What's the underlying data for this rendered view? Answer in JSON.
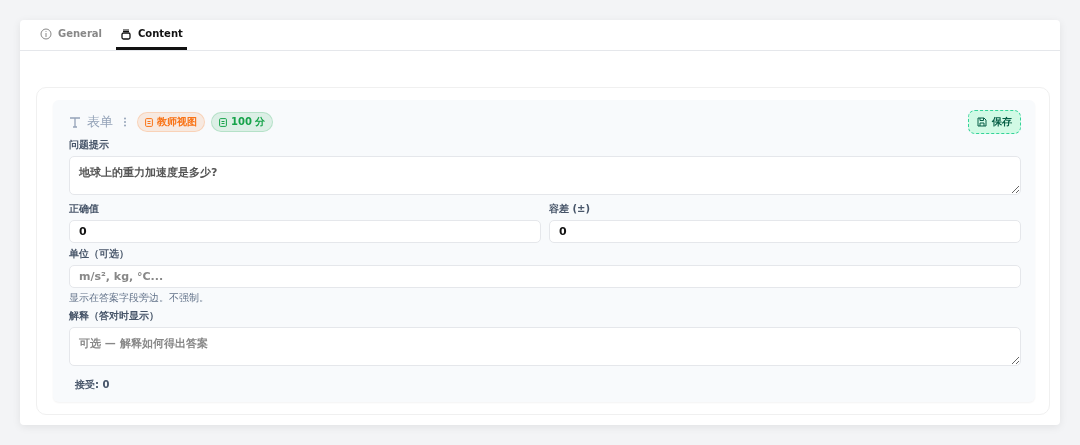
{
  "tabs": [
    {
      "label": "General",
      "kind": "info",
      "selected": false
    },
    {
      "label": "Content",
      "kind": "content",
      "selected": true
    }
  ],
  "block": {
    "title": "表单",
    "badges": [
      {
        "label": "教师视图",
        "color": "#f97316"
      },
      {
        "label": "100 分",
        "color": "#16a34a"
      }
    ],
    "save_button": "保存",
    "fields": [
      {
        "kind": "textarea",
        "label": "问题提示",
        "value": "地球上的重力加速度是多少?"
      },
      {
        "kind": "pair",
        "items": [
          {
            "label": "正确值",
            "value": "0"
          },
          {
            "label": "容差 (±)",
            "value": "0"
          }
        ]
      },
      {
        "kind": "input",
        "label": "单位（可选）",
        "placeholder": "m/s², kg, °C...",
        "hint": "显示在答案字段旁边。不强制。"
      },
      {
        "kind": "textarea",
        "label": "解释（答对时显示）",
        "placeholder": "可选 — 解释如何得出答案"
      }
    ],
    "footer": "接受: 0"
  }
}
